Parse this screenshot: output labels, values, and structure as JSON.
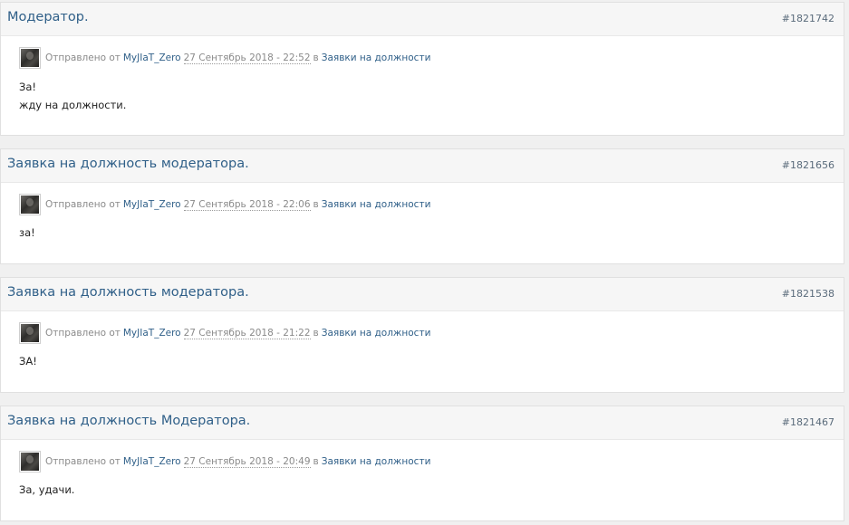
{
  "posts": [
    {
      "title": "Модератор.",
      "id": "#1821742",
      "sent_by_text": "Отправлено от",
      "author": "MyJIaT_Zero",
      "date": "27 Сентябрь 2018 - 22:52",
      "in_text": "в",
      "forum": "Заявки на должности",
      "lines": [
        "За!",
        "жду на должности."
      ]
    },
    {
      "title": "Заявка на должность модератора.",
      "id": "#1821656",
      "sent_by_text": "Отправлено от",
      "author": "MyJIaT_Zero",
      "date": "27 Сентябрь 2018 - 22:06",
      "in_text": "в",
      "forum": "Заявки на должности",
      "lines": [
        "за!"
      ]
    },
    {
      "title": "Заявка на должность модератора.",
      "id": "#1821538",
      "sent_by_text": "Отправлено от",
      "author": "MyJIaT_Zero",
      "date": "27 Сентябрь 2018 - 21:22",
      "in_text": "в",
      "forum": "Заявки на должности",
      "lines": [
        "ЗА!"
      ]
    },
    {
      "title": "Заявка на должность Модератора.",
      "id": "#1821467",
      "sent_by_text": "Отправлено от",
      "author": "MyJIaT_Zero",
      "date": "27 Сентябрь 2018 - 20:49",
      "in_text": "в",
      "forum": "Заявки на должности",
      "lines": [
        "За, удачи."
      ]
    }
  ]
}
